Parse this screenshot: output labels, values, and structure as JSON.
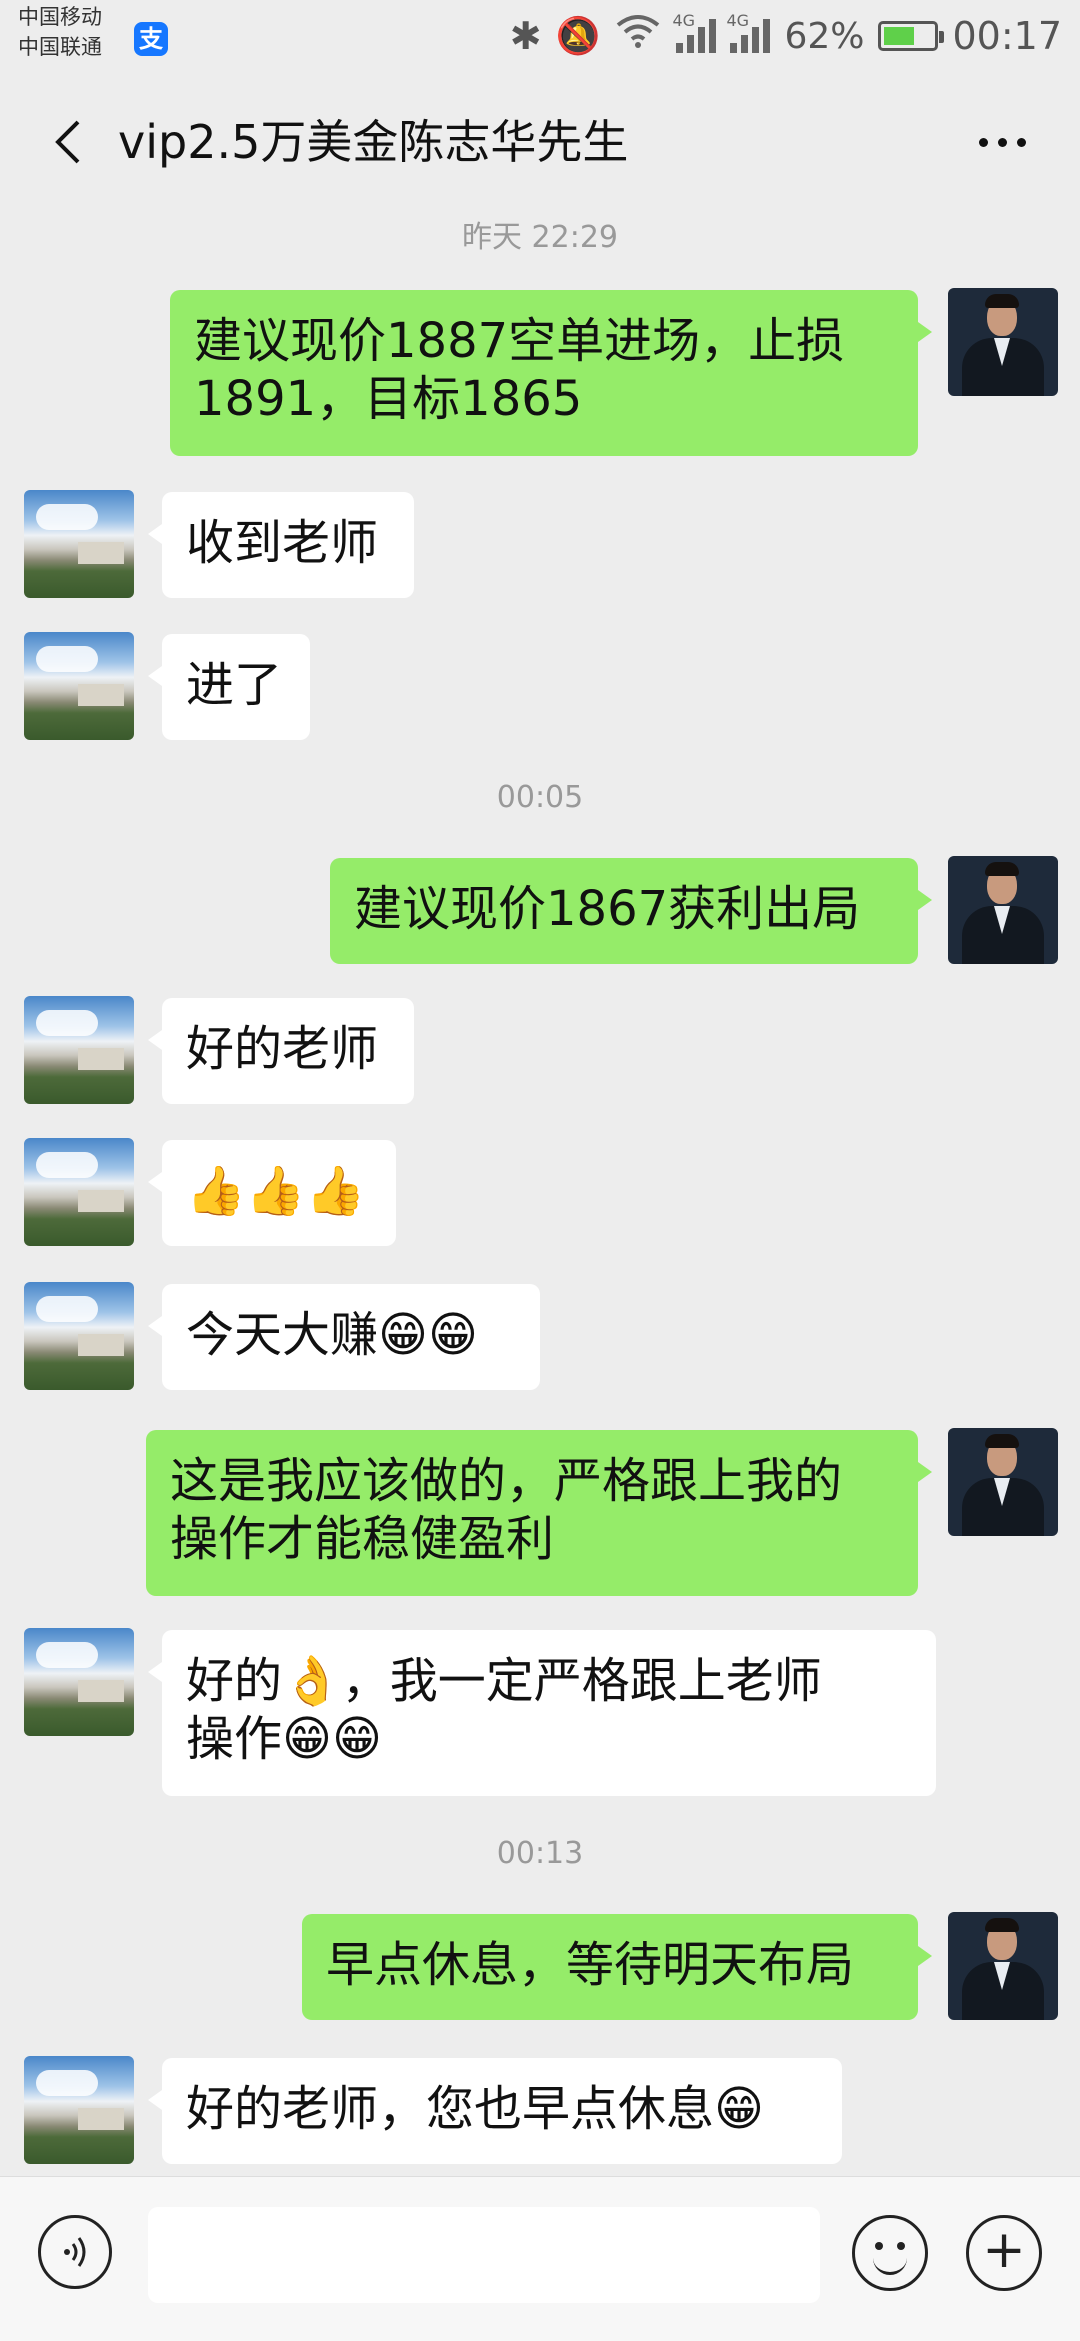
{
  "status_bar": {
    "carrier_1": "中国移动",
    "carrier_2": "中国联通",
    "alipay_glyph": "支",
    "network_1": "4G",
    "network_2": "4G",
    "battery": "62%",
    "battery_level": 0.62,
    "time": "00:17"
  },
  "header": {
    "title": "vip2.5万美金陈志华先生"
  },
  "timestamps": {
    "t1": "昨天 22:29",
    "t2": "00:05",
    "t3": "00:13"
  },
  "messages": [
    {
      "side": "right",
      "text": "建议现价1887空单进场，止损\n1891，目标1865"
    },
    {
      "side": "left",
      "text": "收到老师"
    },
    {
      "side": "left",
      "text": "进了"
    },
    {
      "side": "right",
      "text": "建议现价1867获利出局"
    },
    {
      "side": "left",
      "text": "好的老师"
    },
    {
      "side": "left",
      "text": "👍👍👍"
    },
    {
      "side": "left",
      "text": "今天大赚😁😁"
    },
    {
      "side": "right",
      "text": "这是我应该做的，严格跟上我的\n操作才能稳健盈利"
    },
    {
      "side": "left",
      "text": "好的👌，我一定严格跟上老师\n操作😁😁"
    },
    {
      "side": "right",
      "text": "早点休息，等待明天布局"
    },
    {
      "side": "left",
      "text": "好的老师，您也早点休息😁"
    }
  ],
  "input": {
    "placeholder": ""
  }
}
